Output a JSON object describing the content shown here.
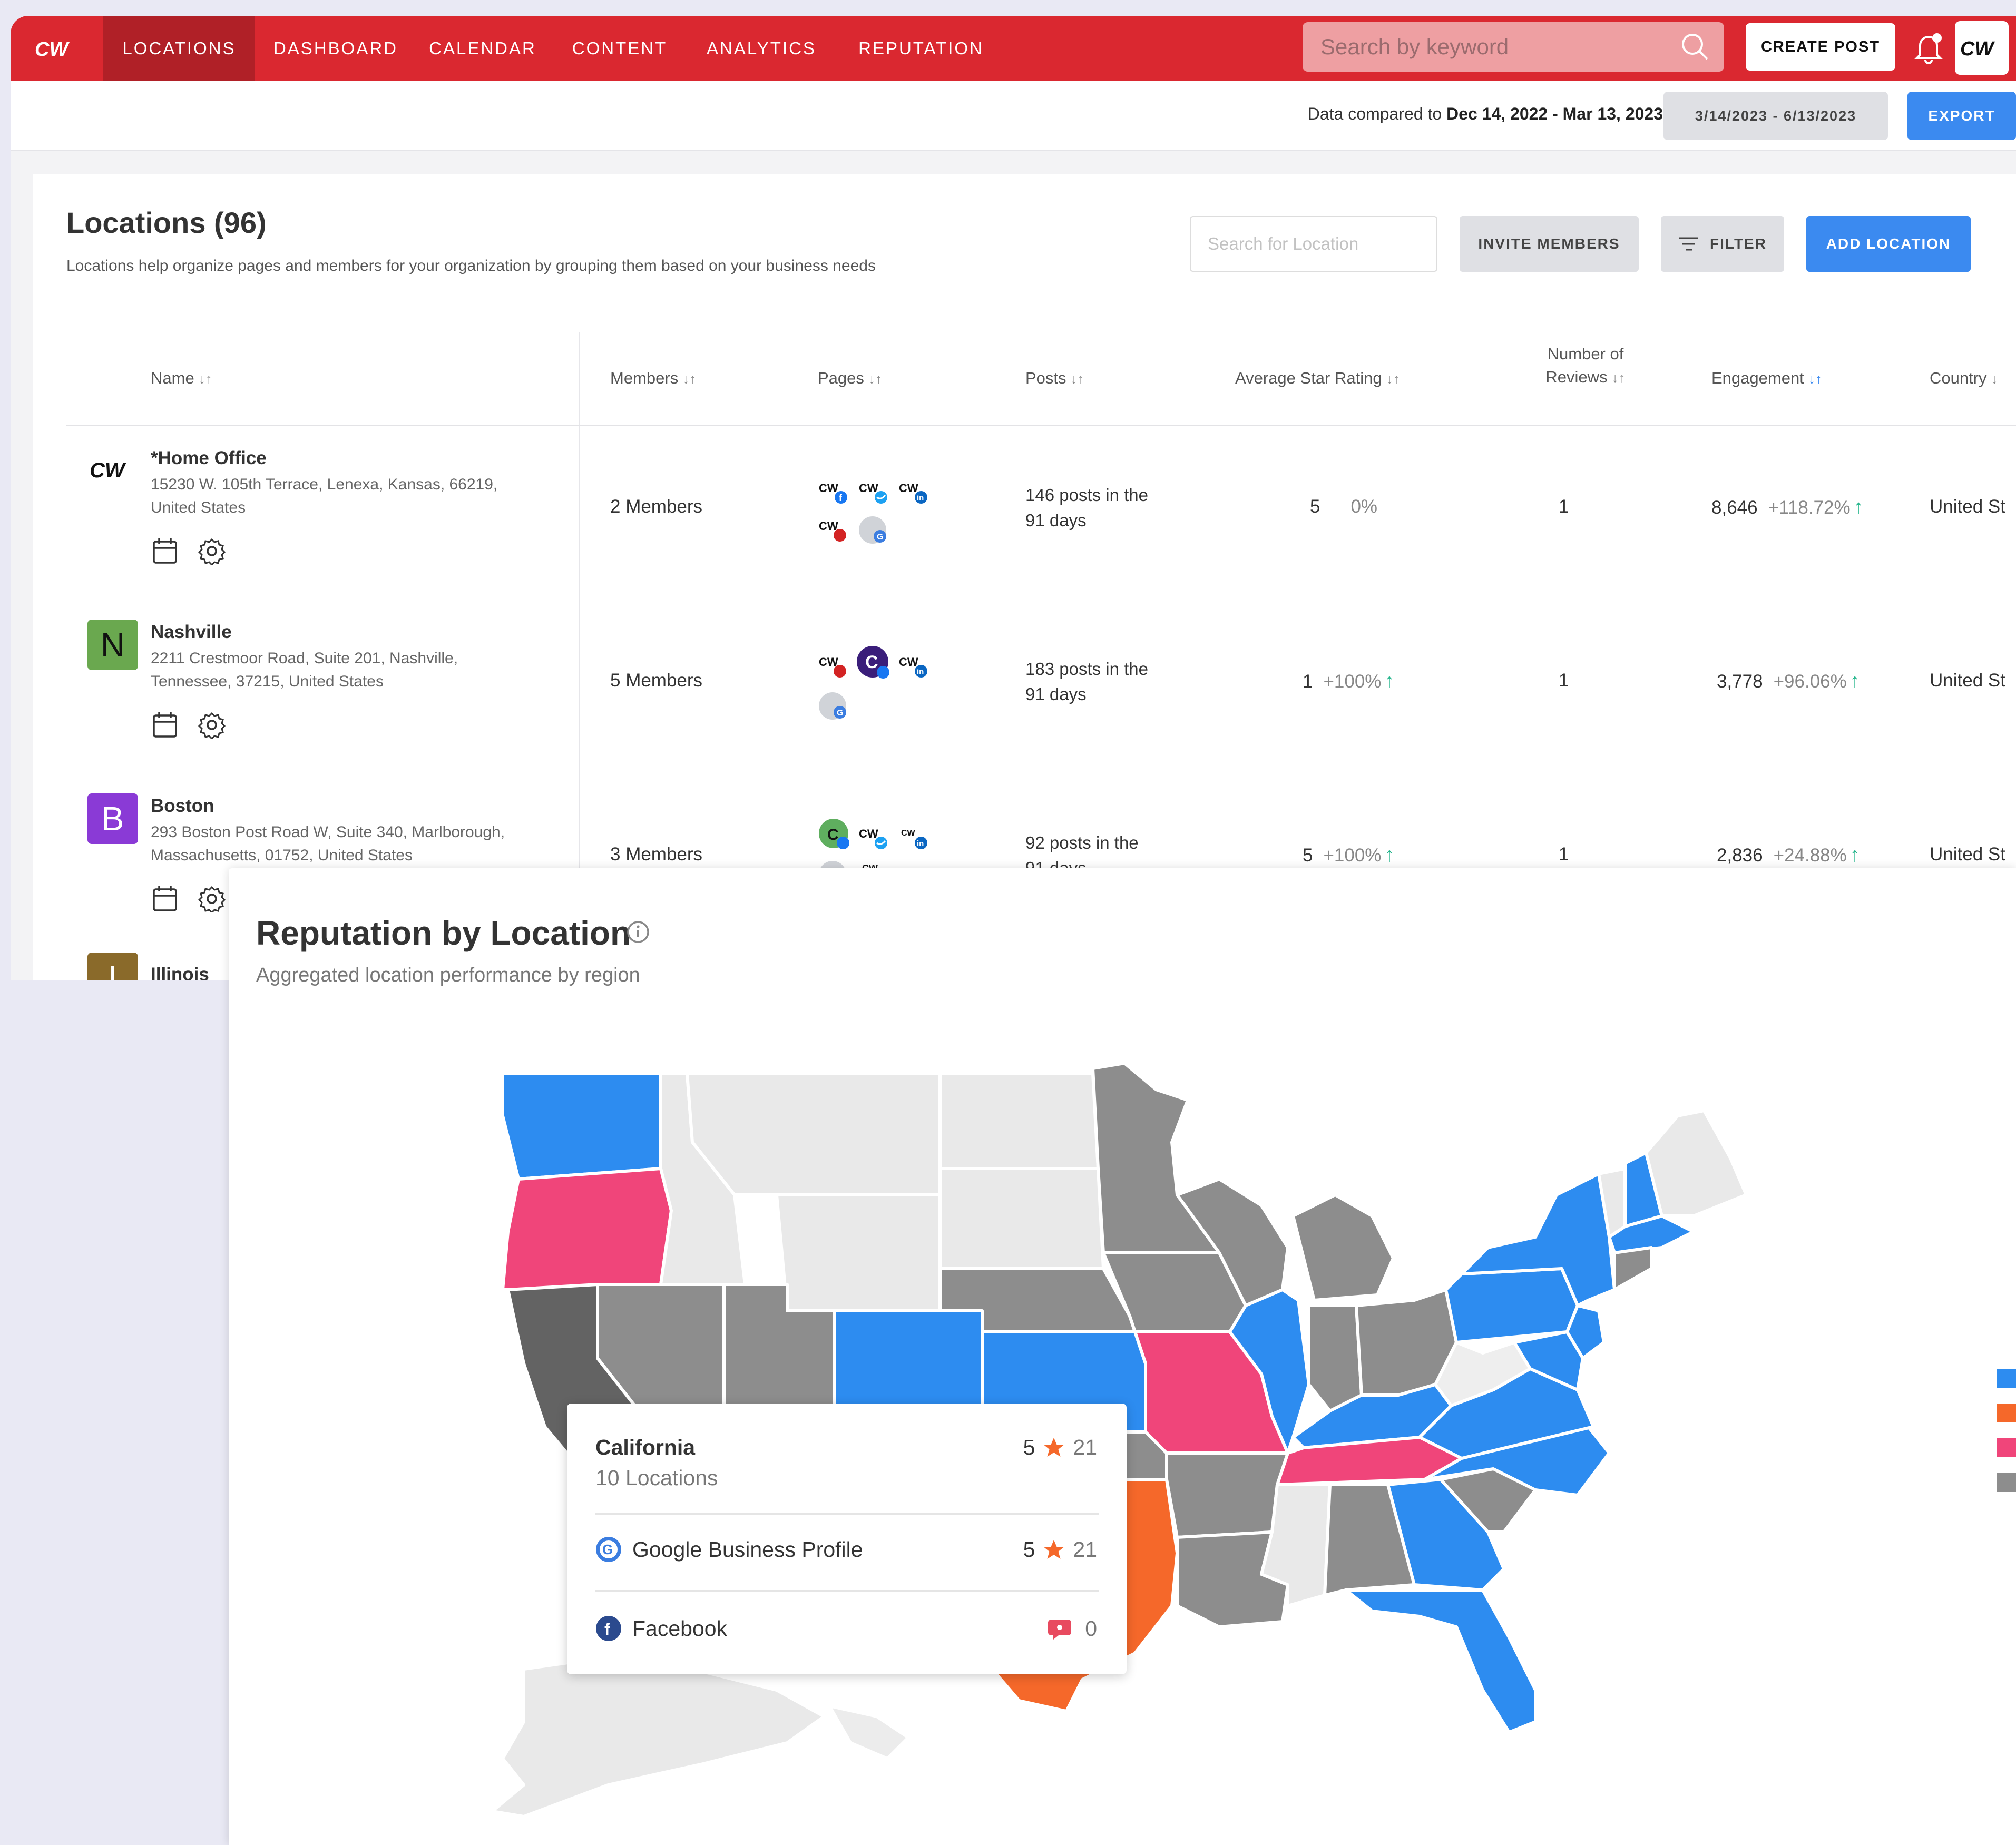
{
  "nav": {
    "items": [
      "LOCATIONS",
      "DASHBOARD",
      "CALENDAR",
      "CONTENT",
      "ANALYTICS",
      "REPUTATION"
    ],
    "active": "LOCATIONS",
    "search_placeholder": "Search by keyword",
    "create_post": "CREATE POST",
    "brand_color": "#da2830"
  },
  "subbar": {
    "compare_prefix": "Data compared to",
    "compare_range": "Dec 14, 2022 - Mar 13, 2023",
    "date_range": "3/14/2023 - 6/13/2023",
    "export": "EXPORT"
  },
  "locations": {
    "title": "Locations (96)",
    "subtitle": "Locations help organize pages and members for your organization by grouping them based on your business needs",
    "search_placeholder": "Search for Location",
    "invite": "INVITE MEMBERS",
    "filter": "FILTER",
    "add": "ADD LOCATION",
    "columns": {
      "name": "Name",
      "members": "Members",
      "pages": "Pages",
      "posts": "Posts",
      "rating": "Average Star Rating",
      "reviews_1": "Number of",
      "reviews_2": "Reviews",
      "engagement": "Engagement",
      "country": "Country"
    },
    "rows": [
      {
        "name": "*Home Office",
        "addr1": "15230 W. 105th Terrace, Lenexa, Kansas, 66219,",
        "addr2": "United States",
        "badge": "",
        "members": "2 Members",
        "posts1": "146 posts in the",
        "posts2": "91 days",
        "rating": "5",
        "rating_change": "0%",
        "reviews": "1",
        "engagement": "8,646",
        "engagement_change": "+118.72%",
        "country": "United St"
      },
      {
        "name": "Nashville",
        "addr1": "2211 Crestmoor Road, Suite 201, Nashville,",
        "addr2": "Tennessee, 37215, United States",
        "badge": "N",
        "badge_color": "#6aa84f",
        "members": "5 Members",
        "posts1": "183 posts in the",
        "posts2": "91 days",
        "rating": "1",
        "rating_change": "+100%",
        "reviews": "1",
        "engagement": "3,778",
        "engagement_change": "+96.06%",
        "country": "United St"
      },
      {
        "name": "Boston",
        "addr1": "293 Boston Post Road W, Suite 340, Marlborough,",
        "addr2": "Massachusetts, 01752, United States",
        "badge": "B",
        "badge_color": "#8a3ad6",
        "members": "3 Members",
        "posts1": "92 posts in the",
        "posts2": "91 days",
        "rating": "5",
        "rating_change": "+100%",
        "reviews": "1",
        "engagement": "2,836",
        "engagement_change": "+24.88%",
        "country": "United St"
      },
      {
        "name": "Illinois",
        "badge": "I",
        "badge_color": "#8a6a2a"
      }
    ]
  },
  "reputation": {
    "title": "Reputation by Location",
    "subtitle": "Aggregated location performance by region",
    "legend_colors": [
      "#2d8cf0",
      "#f5682a",
      "#f0457a",
      "#8d8d8d"
    ],
    "tooltip": {
      "state": "California",
      "locations": "10 Locations",
      "rating": "5",
      "count": "21",
      "rows": [
        {
          "icon": "google-icon",
          "label": "Google Business Profile",
          "rating": "5",
          "count": "21"
        },
        {
          "icon": "facebook-icon",
          "label": "Facebook",
          "count": "0"
        }
      ]
    }
  }
}
